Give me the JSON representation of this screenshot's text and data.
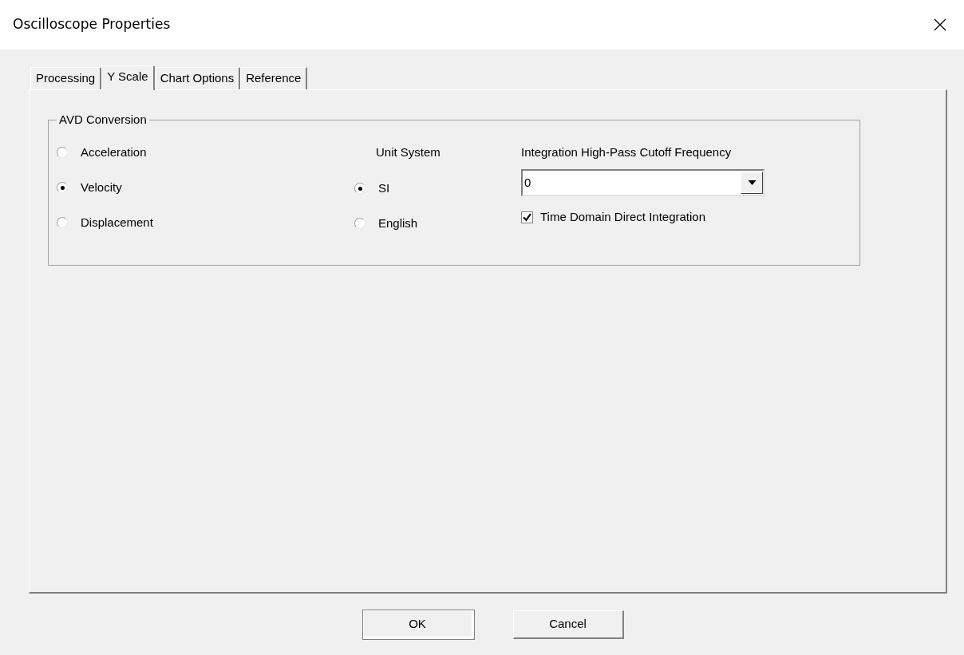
{
  "window": {
    "title": "Oscilloscope Properties"
  },
  "tabs": [
    {
      "label": "Processing",
      "selected": false
    },
    {
      "label": "Y Scale",
      "selected": true
    },
    {
      "label": "Chart Options",
      "selected": false
    },
    {
      "label": "Reference",
      "selected": false
    }
  ],
  "group": {
    "title": "AVD Conversion",
    "conversion": [
      {
        "label": "Acceleration",
        "selected": false
      },
      {
        "label": "Velocity",
        "selected": true
      },
      {
        "label": "Displacement",
        "selected": false
      }
    ],
    "unit_system": {
      "heading": "Unit System",
      "options": [
        {
          "label": "SI",
          "selected": true
        },
        {
          "label": "English",
          "selected": false
        }
      ]
    },
    "cutoff": {
      "heading": "Integration High-Pass Cutoff Frequency",
      "value": "0"
    },
    "direct_integration": {
      "label": "Time Domain Direct Integration",
      "checked": true
    }
  },
  "buttons": [
    {
      "label": "OK",
      "default": true
    },
    {
      "label": "Cancel",
      "default": false
    }
  ]
}
